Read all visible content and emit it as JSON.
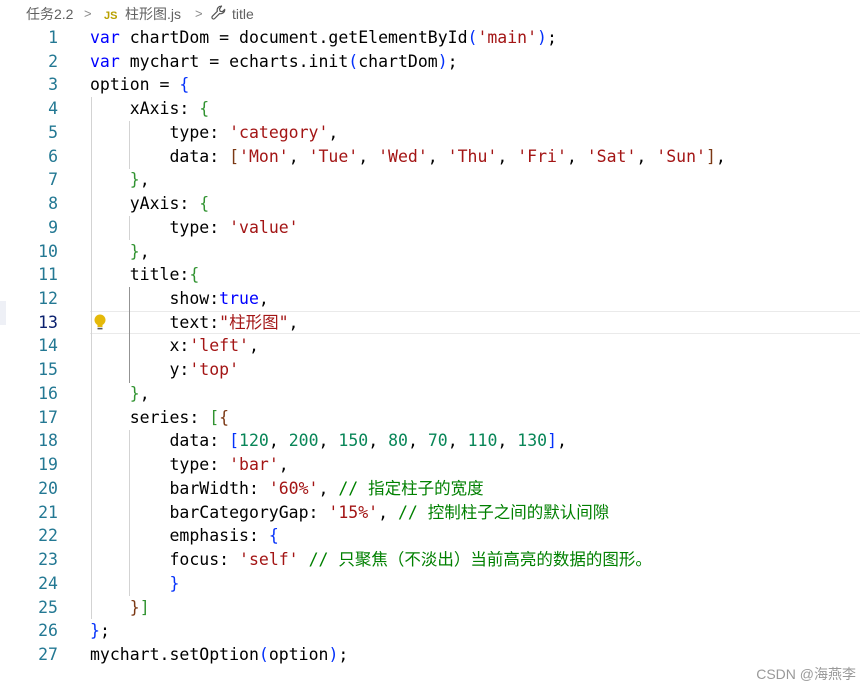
{
  "breadcrumb": {
    "folder": "任务2.2",
    "file_badge": "JS",
    "file": "柱形图.js",
    "symbol": "title",
    "separator": ">"
  },
  "editor": {
    "active_line": 13,
    "lines": [
      {
        "num": "1",
        "tokens": [
          {
            "t": "kw",
            "v": "var"
          },
          {
            "t": "pl",
            "v": " chartDom = document.getElementById"
          },
          {
            "t": "b1",
            "v": "("
          },
          {
            "t": "str",
            "v": "'main'"
          },
          {
            "t": "b1",
            "v": ")"
          },
          {
            "t": "pl",
            "v": ";"
          }
        ]
      },
      {
        "num": "2",
        "tokens": [
          {
            "t": "kw",
            "v": "var"
          },
          {
            "t": "pl",
            "v": " mychart = echarts.init"
          },
          {
            "t": "b1",
            "v": "("
          },
          {
            "t": "pl",
            "v": "chartDom"
          },
          {
            "t": "b1",
            "v": ")"
          },
          {
            "t": "pl",
            "v": ";"
          }
        ]
      },
      {
        "num": "3",
        "tokens": [
          {
            "t": "pl",
            "v": "option = "
          },
          {
            "t": "b1",
            "v": "{"
          }
        ]
      },
      {
        "num": "4",
        "tokens": [
          {
            "t": "pl",
            "v": "    xAxis: "
          },
          {
            "t": "b2",
            "v": "{"
          }
        ]
      },
      {
        "num": "5",
        "tokens": [
          {
            "t": "pl",
            "v": "        type: "
          },
          {
            "t": "str",
            "v": "'category'"
          },
          {
            "t": "pl",
            "v": ","
          }
        ]
      },
      {
        "num": "6",
        "tokens": [
          {
            "t": "pl",
            "v": "        data: "
          },
          {
            "t": "b3",
            "v": "["
          },
          {
            "t": "str",
            "v": "'Mon'"
          },
          {
            "t": "pl",
            "v": ", "
          },
          {
            "t": "str",
            "v": "'Tue'"
          },
          {
            "t": "pl",
            "v": ", "
          },
          {
            "t": "str",
            "v": "'Wed'"
          },
          {
            "t": "pl",
            "v": ", "
          },
          {
            "t": "str",
            "v": "'Thu'"
          },
          {
            "t": "pl",
            "v": ", "
          },
          {
            "t": "str",
            "v": "'Fri'"
          },
          {
            "t": "pl",
            "v": ", "
          },
          {
            "t": "str",
            "v": "'Sat'"
          },
          {
            "t": "pl",
            "v": ", "
          },
          {
            "t": "str",
            "v": "'Sun'"
          },
          {
            "t": "b3",
            "v": "]"
          },
          {
            "t": "pl",
            "v": ","
          }
        ]
      },
      {
        "num": "7",
        "tokens": [
          {
            "t": "pl",
            "v": "    "
          },
          {
            "t": "b2",
            "v": "}"
          },
          {
            "t": "pl",
            "v": ","
          }
        ]
      },
      {
        "num": "8",
        "tokens": [
          {
            "t": "pl",
            "v": "    yAxis: "
          },
          {
            "t": "b2",
            "v": "{"
          }
        ]
      },
      {
        "num": "9",
        "tokens": [
          {
            "t": "pl",
            "v": "        type: "
          },
          {
            "t": "str",
            "v": "'value'"
          }
        ]
      },
      {
        "num": "10",
        "tokens": [
          {
            "t": "pl",
            "v": "    "
          },
          {
            "t": "b2",
            "v": "}"
          },
          {
            "t": "pl",
            "v": ","
          }
        ]
      },
      {
        "num": "11",
        "tokens": [
          {
            "t": "pl",
            "v": "    title:"
          },
          {
            "t": "b2",
            "v": "{"
          }
        ]
      },
      {
        "num": "12",
        "tokens": [
          {
            "t": "pl",
            "v": "        show:"
          },
          {
            "t": "kw",
            "v": "true"
          },
          {
            "t": "pl",
            "v": ","
          }
        ]
      },
      {
        "num": "13",
        "tokens": [
          {
            "t": "pl",
            "v": "        text:"
          },
          {
            "t": "str",
            "v": "\"柱形图\""
          },
          {
            "t": "pl",
            "v": ","
          }
        ]
      },
      {
        "num": "14",
        "tokens": [
          {
            "t": "pl",
            "v": "        x:"
          },
          {
            "t": "str",
            "v": "'left'"
          },
          {
            "t": "pl",
            "v": ","
          }
        ]
      },
      {
        "num": "15",
        "tokens": [
          {
            "t": "pl",
            "v": "        y:"
          },
          {
            "t": "str",
            "v": "'top'"
          }
        ]
      },
      {
        "num": "16",
        "tokens": [
          {
            "t": "pl",
            "v": "    "
          },
          {
            "t": "b2",
            "v": "}"
          },
          {
            "t": "pl",
            "v": ","
          }
        ]
      },
      {
        "num": "17",
        "tokens": [
          {
            "t": "pl",
            "v": "    series: "
          },
          {
            "t": "b2",
            "v": "["
          },
          {
            "t": "b3",
            "v": "{"
          }
        ]
      },
      {
        "num": "18",
        "tokens": [
          {
            "t": "pl",
            "v": "        data: "
          },
          {
            "t": "b1",
            "v": "["
          },
          {
            "t": "num",
            "v": "120"
          },
          {
            "t": "pl",
            "v": ", "
          },
          {
            "t": "num",
            "v": "200"
          },
          {
            "t": "pl",
            "v": ", "
          },
          {
            "t": "num",
            "v": "150"
          },
          {
            "t": "pl",
            "v": ", "
          },
          {
            "t": "num",
            "v": "80"
          },
          {
            "t": "pl",
            "v": ", "
          },
          {
            "t": "num",
            "v": "70"
          },
          {
            "t": "pl",
            "v": ", "
          },
          {
            "t": "num",
            "v": "110"
          },
          {
            "t": "pl",
            "v": ", "
          },
          {
            "t": "num",
            "v": "130"
          },
          {
            "t": "b1",
            "v": "]"
          },
          {
            "t": "pl",
            "v": ","
          }
        ]
      },
      {
        "num": "19",
        "tokens": [
          {
            "t": "pl",
            "v": "        type: "
          },
          {
            "t": "str",
            "v": "'bar'"
          },
          {
            "t": "pl",
            "v": ","
          }
        ]
      },
      {
        "num": "20",
        "tokens": [
          {
            "t": "pl",
            "v": "        barWidth: "
          },
          {
            "t": "str",
            "v": "'60%'"
          },
          {
            "t": "pl",
            "v": ", "
          },
          {
            "t": "com",
            "v": "// 指定柱子的宽度"
          }
        ]
      },
      {
        "num": "21",
        "tokens": [
          {
            "t": "pl",
            "v": "        barCategoryGap: "
          },
          {
            "t": "str",
            "v": "'15%'"
          },
          {
            "t": "pl",
            "v": ", "
          },
          {
            "t": "com",
            "v": "// 控制柱子之间的默认间隙"
          }
        ]
      },
      {
        "num": "22",
        "tokens": [
          {
            "t": "pl",
            "v": "        emphasis: "
          },
          {
            "t": "b1",
            "v": "{"
          }
        ]
      },
      {
        "num": "23",
        "tokens": [
          {
            "t": "pl",
            "v": "        focus: "
          },
          {
            "t": "str",
            "v": "'self'"
          },
          {
            "t": "pl",
            "v": " "
          },
          {
            "t": "com",
            "v": "// 只聚焦（不淡出）当前高亮的数据的图形。"
          }
        ]
      },
      {
        "num": "24",
        "tokens": [
          {
            "t": "pl",
            "v": "        "
          },
          {
            "t": "b1",
            "v": "}"
          }
        ]
      },
      {
        "num": "25",
        "tokens": [
          {
            "t": "pl",
            "v": "    "
          },
          {
            "t": "b3",
            "v": "}"
          },
          {
            "t": "b2",
            "v": "]"
          }
        ]
      },
      {
        "num": "26",
        "tokens": [
          {
            "t": "b1",
            "v": "}"
          },
          {
            "t": "pl",
            "v": ";"
          }
        ]
      },
      {
        "num": "27",
        "tokens": [
          {
            "t": "pl",
            "v": "mychart.setOption"
          },
          {
            "t": "b1",
            "v": "("
          },
          {
            "t": "pl",
            "v": "option"
          },
          {
            "t": "b1",
            "v": ")"
          },
          {
            "t": "pl",
            "v": ";"
          }
        ]
      }
    ]
  },
  "watermark": "CSDN @海燕李",
  "icons": {
    "folder_sep": "chevron-right-icon",
    "symbol": "wrench-icon",
    "hint": "lightbulb-icon"
  },
  "colors": {
    "keyword": "#0000ff",
    "string": "#a31515",
    "number": "#098658",
    "comment": "#008000",
    "line_number": "#237893",
    "bulb": "#e5b909"
  }
}
